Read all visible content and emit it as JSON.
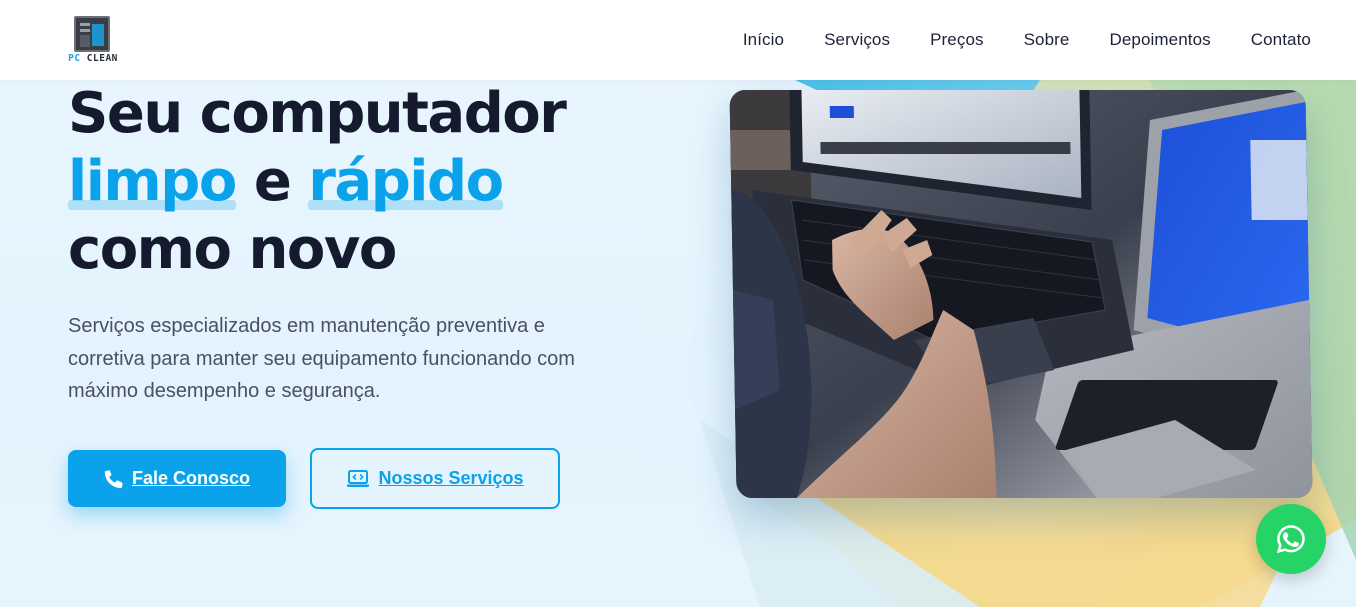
{
  "brand": {
    "logo_pc": "PC",
    "logo_clean": "CLEAN",
    "accent_color": "#0aa2eb",
    "dark_color": "#151a2e"
  },
  "nav": {
    "items": [
      "Início",
      "Serviços",
      "Preços",
      "Sobre",
      "Depoimentos",
      "Contato"
    ]
  },
  "hero": {
    "title_line1": "Seu computador",
    "title_word_limpo": "limpo",
    "title_word_e": "e",
    "title_word_rapido": "rápido",
    "title_line3": "como novo",
    "description": "Serviços especializados em manutenção preventiva e corretiva para manter seu equipamento funcionando com máximo desempenho e segurança.",
    "image_alt": "Pessoa digitando em laptop Dell ao lado de um MacBook"
  },
  "buttons": {
    "primary_label": "Fale Conosco",
    "primary_icon": "phone-icon",
    "secondary_label": "Nossos Serviços",
    "secondary_icon": "laptop-code-icon"
  },
  "whatsapp": {
    "icon": "whatsapp-icon",
    "color": "#25d366"
  }
}
